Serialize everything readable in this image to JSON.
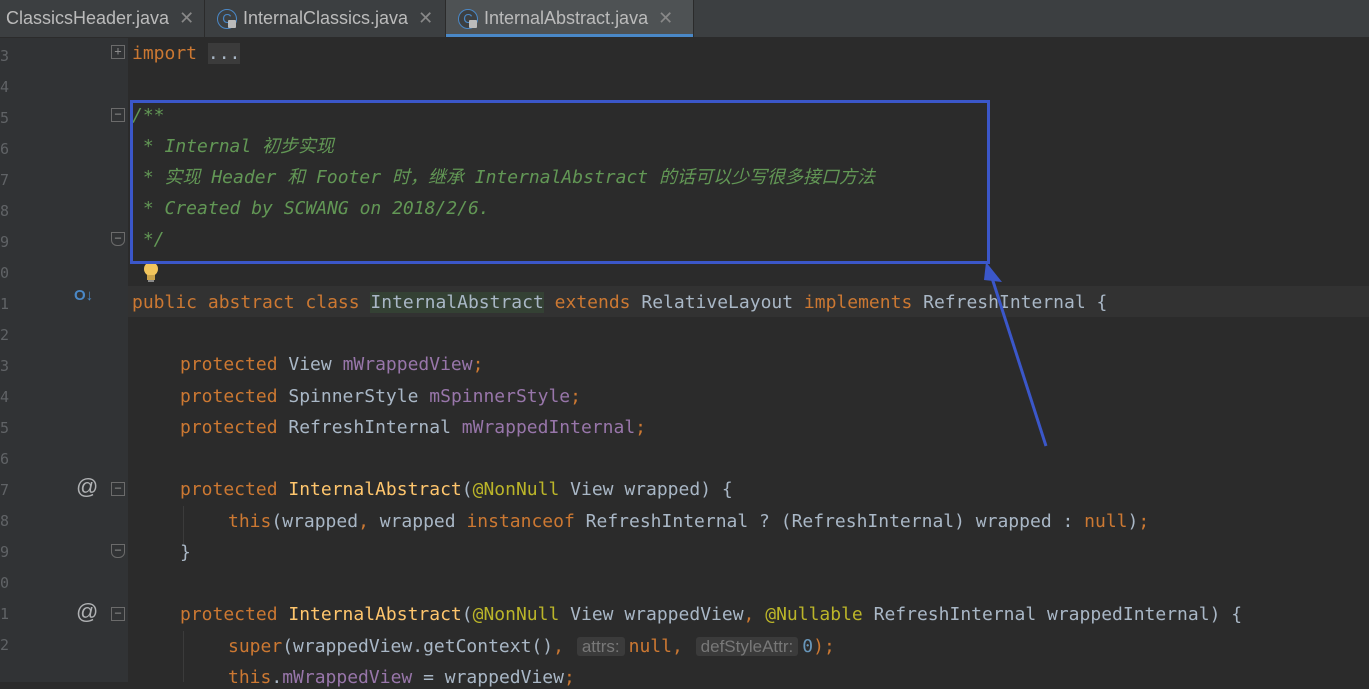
{
  "tabs": [
    {
      "label": "ClassicsHeader.java",
      "active": false
    },
    {
      "label": "InternalClassics.java",
      "active": false
    },
    {
      "label": "InternalAbstract.java",
      "active": true
    }
  ],
  "icons": {
    "class_icon_glyph": "C",
    "close_glyph": "✕",
    "bulb_icon": "bulb-icon",
    "override_icon": "override-icon"
  },
  "gutter": {
    "line_numbers": [
      "3",
      "4",
      "5",
      "6",
      "7",
      "8",
      "9",
      "0",
      "1",
      "2",
      "3",
      "4",
      "5",
      "6",
      "7",
      "8",
      "9",
      "0",
      "1",
      "2"
    ],
    "override_marker": "@",
    "implements_marker": "O↓"
  },
  "code": {
    "l1": {
      "kw": "import",
      "rest": " ",
      "folded": "..."
    },
    "l3": "/**",
    "l4": " * Internal 初步实现",
    "l5": " * 实现 Header 和 Footer 时，继承 InternalAbstract 的话可以少写很多接口方法",
    "l6": " * Created by SCWANG on 2018/2/6.",
    "l7": " */",
    "l9": {
      "kw1": "public abstract class ",
      "cls": "InternalAbstract",
      "kw2": " extends ",
      "base": "RelativeLayout",
      "kw3": " implements ",
      "iface": "RefreshInternal",
      "brace": " {"
    },
    "l11": {
      "kw": "protected ",
      "type": "View ",
      "field": "mWrappedView",
      "semi": ";"
    },
    "l12": {
      "kw": "protected ",
      "type": "SpinnerStyle ",
      "field": "mSpinnerStyle",
      "semi": ";"
    },
    "l13": {
      "kw": "protected ",
      "type": "RefreshInternal ",
      "field": "mWrappedInternal",
      "semi": ";"
    },
    "l15": {
      "kw": "protected ",
      "fn": "InternalAbstract",
      "p1": "(",
      "an": "@NonNull",
      "rest": " View wrapped) {"
    },
    "l16": {
      "kw": "this",
      "a": "(wrapped",
      "c1": ", ",
      "b": "wrapped ",
      "kw2": "instanceof",
      "c": " RefreshInternal ? (RefreshInternal) wrapped : ",
      "kw3": "null",
      "d": ")",
      "e": ";"
    },
    "l17": "}",
    "l19": {
      "kw": "protected ",
      "fn": "InternalAbstract",
      "p1": "(",
      "an1": "@NonNull",
      "mid": " View wrappedView",
      "comma": ", ",
      "an2": "@Nullable",
      "rest": " RefreshInternal wrappedInternal) {"
    },
    "l20": {
      "kw": "super",
      "a": "(wrappedView.getContext()",
      "c1": ", ",
      "h1": "attrs:",
      "n1": "null",
      "c2": ", ",
      "h2": "defStyleAttr:",
      "num": "0",
      "e": ");"
    },
    "l21": {
      "kw": "this",
      "a": ".",
      "field": "mWrappedView",
      "b": " = wrappedView",
      "e": ";"
    }
  },
  "colors": {
    "annotation_box": "#3b57c9",
    "active_tab_underline": "#4a88c7"
  }
}
